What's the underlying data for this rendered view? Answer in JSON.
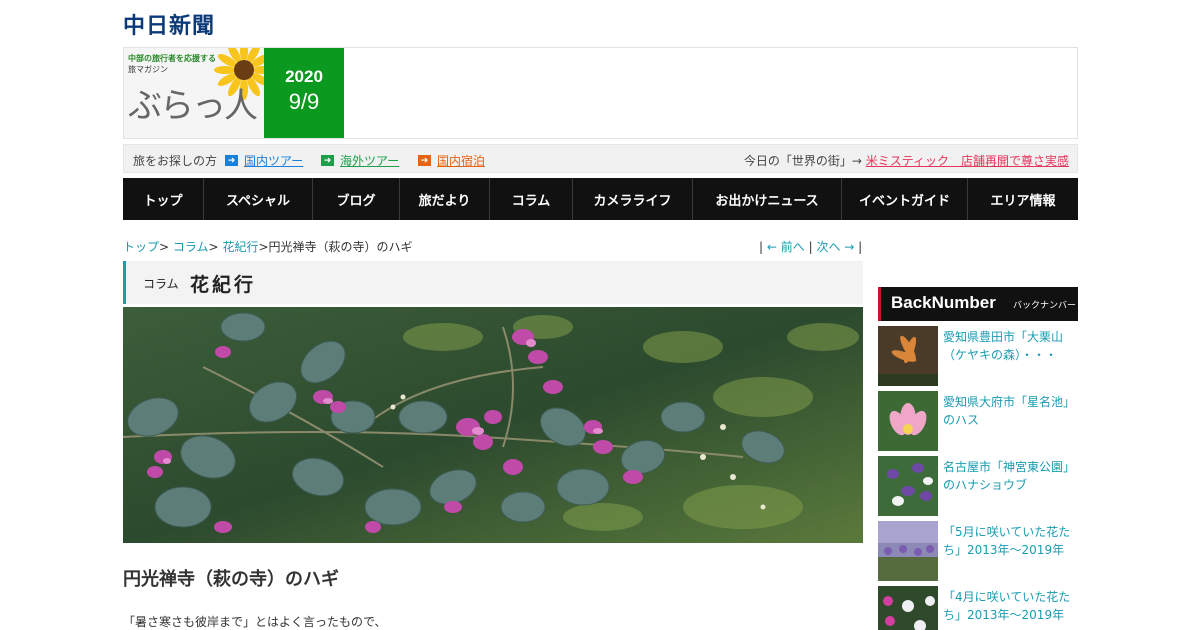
{
  "logo": {
    "text": "中日新聞"
  },
  "banner": {
    "tagline": "中部の旅行者を応援する",
    "subtitle": "旅マガジン",
    "title": "ぶらっ人",
    "year": "2020",
    "date": "9/9"
  },
  "searchbar": {
    "label": "旅をお探しの方",
    "links": [
      {
        "label": "国内ツアー",
        "color": "#1a7fd6"
      },
      {
        "label": "海外ツアー",
        "color": "#1f9e4a"
      },
      {
        "label": "国内宿泊",
        "color": "#e8620f"
      }
    ],
    "today_label": "今日の「世界の街」→",
    "today_link": "米ミスティック　店舗再開で尊さ実感"
  },
  "nav": [
    "トップ",
    "スペシャル",
    "ブログ",
    "旅だより",
    "コラム",
    "カメラライフ",
    "お出かけニュース",
    "イベントガイド",
    "エリア情報"
  ],
  "breadcrumb": {
    "items": [
      "トップ",
      "コラム",
      "花紀行"
    ],
    "sep": ">",
    "current": "円光禅寺（萩の寺）のハギ"
  },
  "pager": {
    "prev": "← 前へ",
    "next": "次へ →",
    "bar": "|"
  },
  "section": {
    "small": "コラム",
    "big": "花紀行"
  },
  "article": {
    "title": "円光禅寺（萩の寺）のハギ",
    "lead": "「暑さ寒さも彼岸まで」とはよく言ったもので、"
  },
  "sidebar": {
    "head": "BackNumber",
    "head_sub": "バックナンバー",
    "items": [
      {
        "caption": "愛知県豊田市「大栗山（ケヤキの森）・・・"
      },
      {
        "caption": "愛知県大府市「星名池」のハス"
      },
      {
        "caption": "名古屋市「神宮東公園」のハナショウブ"
      },
      {
        "caption": "「5月に咲いていた花たち」2013年～2019年"
      },
      {
        "caption": "「4月に咲いていた花たち」2013年～2019年"
      }
    ]
  },
  "colors": {
    "accent": "#1a9bb0",
    "nav_bg": "#111111",
    "date_green": "#0b9a1f",
    "link_red": "#e8335a",
    "bn_red": "#c6162c"
  },
  "icons": {
    "link_arrow": "arrow-right-icon"
  }
}
